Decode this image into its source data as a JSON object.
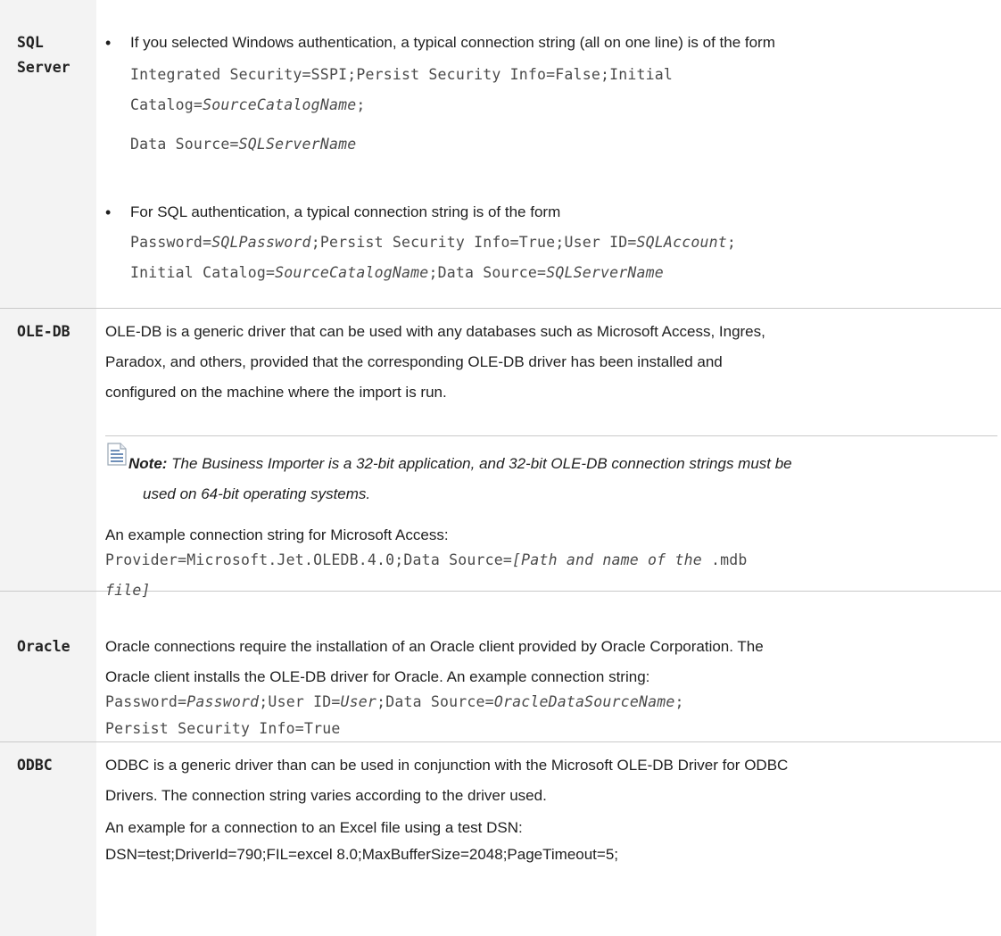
{
  "rows": [
    {
      "label_lines": [
        "SQL",
        "Server"
      ],
      "bullets": [
        {
          "intro": "If you selected Windows authentication, a typical connection string (all on one line) is of the form",
          "code_lines": [
            [
              {
                "t": "Integrated Security=SSPI;Persist Security Info=False;Initial"
              }
            ],
            [
              {
                "t": "Catalog="
              },
              {
                "t": "SourceCatalogName",
                "i": true
              },
              {
                "t": ";"
              }
            ],
            [
              {
                "t": "Data Source="
              },
              {
                "t": "SQLServerName",
                "i": true
              }
            ]
          ]
        },
        {
          "intro": "For SQL authentication, a typical connection string is of the form",
          "code_lines": [
            [
              {
                "t": "Password="
              },
              {
                "t": "SQLPassword",
                "i": true
              },
              {
                "t": ";Persist Security Info=True;User ID="
              },
              {
                "t": "SQLAccount",
                "i": true
              },
              {
                "t": ";"
              }
            ],
            [
              {
                "t": "Initial Catalog="
              },
              {
                "t": "SourceCatalogName",
                "i": true
              },
              {
                "t": ";Data Source="
              },
              {
                "t": "SQLServerName",
                "i": true
              }
            ]
          ]
        }
      ]
    },
    {
      "label": "OLE-DB",
      "paragraph_lines": [
        "OLE-DB is a generic driver that can be used with any databases such as Microsoft Access, Ingres,",
        "Paradox, and others, provided that the corresponding OLE-DB driver has been installed and",
        "configured on the machine where the import is run."
      ],
      "note_label": "Note:",
      "note_lines": [
        " The Business Importer is a 32-bit application, and 32-bit OLE-DB connection strings must be",
        "used on 64-bit operating systems."
      ],
      "example_intro": "An example connection string for Microsoft Access:",
      "code_lines": [
        [
          {
            "t": "Provider=Microsoft.Jet.OLEDB.4.0;Data Source="
          },
          {
            "t": "[Path and name of the",
            "i": true
          },
          {
            "t": " .mdb"
          }
        ],
        [
          {
            "t": "file]",
            "i": true
          }
        ]
      ]
    },
    {
      "label": "Oracle",
      "paragraph_lines": [
        "Oracle connections require the installation of an Oracle client provided by Oracle Corporation. The",
        "Oracle client installs the OLE-DB driver for Oracle. An example connection string:"
      ],
      "code_lines": [
        [
          {
            "t": "Password="
          },
          {
            "t": "Password",
            "i": true
          },
          {
            "t": ";User ID="
          },
          {
            "t": "User",
            "i": true
          },
          {
            "t": ";Data Source="
          },
          {
            "t": "OracleDataSourceName",
            "i": true
          },
          {
            "t": ";"
          }
        ],
        [
          {
            "t": "Persist Security Info=True"
          }
        ]
      ]
    },
    {
      "label": "ODBC",
      "paragraph_lines": [
        "ODBC is a generic driver than can be used in conjunction with the Microsoft OLE-DB Driver for ODBC",
        "Drivers. The connection string varies according to the driver used."
      ],
      "example_intro": "An example for a connection to an Excel file using a test DSN:",
      "example_text": "DSN=test;DriverId=790;FIL=excel 8.0;MaxBufferSize=2048;PageTimeout=5;"
    }
  ]
}
